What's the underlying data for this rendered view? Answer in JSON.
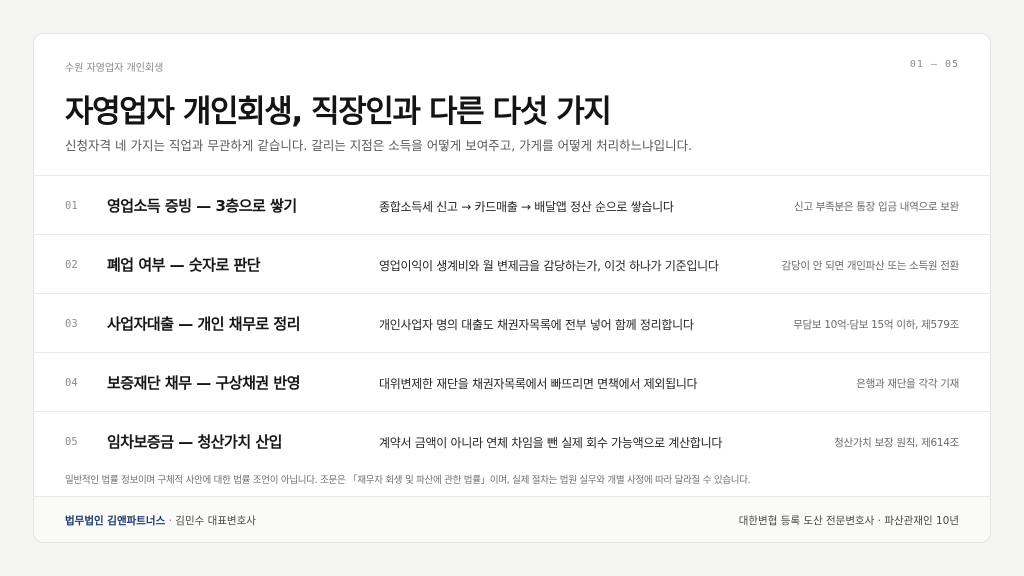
{
  "header": {
    "eyebrow": "수원 자영업자 개인회생",
    "pager": "01 — 05",
    "title": "자영업자 개인회생, 직장인과 다른 다섯 가지",
    "subtitle": "신청자격 네 가지는 직업과 무관하게 같습니다. 갈리는 지점은 소득을 어떻게 보여주고, 가게를 어떻게 처리하느냐입니다."
  },
  "rows": [
    {
      "num": "01",
      "title": "영업소득 증빙 — 3층으로 쌓기",
      "desc": "종합소득세 신고 → 카드매출 → 배달앱 정산 순으로 쌓습니다",
      "note": "신고 부족분은 통장 입금 내역으로 보완"
    },
    {
      "num": "02",
      "title": "폐업 여부 — 숫자로 판단",
      "desc": "영업이익이 생계비와 월 변제금을 감당하는가, 이것 하나가 기준입니다",
      "note": "감당이 안 되면 개인파산 또는 소득원 전환"
    },
    {
      "num": "03",
      "title": "사업자대출 — 개인 채무로 정리",
      "desc": "개인사업자 명의 대출도 채권자목록에 전부 넣어 함께 정리합니다",
      "note": "무담보 10억·담보 15억 이하, 제579조"
    },
    {
      "num": "04",
      "title": "보증재단 채무 — 구상채권 반영",
      "desc": "대위변제한 재단을 채권자목록에서 빠뜨리면 면책에서 제외됩니다",
      "note": "은행과 재단을 각각 기재"
    },
    {
      "num": "05",
      "title": "임차보증금 — 청산가치 산입",
      "desc": "계약서 금액이 아니라 연체 차임을 뺀 실제 회수 가능액으로 계산합니다",
      "note": "청산가치 보장 원칙, 제614조"
    }
  ],
  "disclaimer": "일반적인 법률 정보이며 구체적 사안에 대한 법률 조언이 아닙니다. 조문은 「채무자 회생 및 파산에 관한 법률」이며, 실제 절차는 법원 실무와 개별 사정에 따라 달라질 수 있습니다.",
  "footer": {
    "firm_name": "법무법인 김앤파트너스",
    "separator": " · ",
    "person": "김민수 대표변호사",
    "credentials": "대한변협 등록 도산 전문변호사 · 파산관재인 10년"
  },
  "colors": {
    "brand": "#1f3a6b",
    "background": "#f5f5f4",
    "card": "#ffffff"
  }
}
